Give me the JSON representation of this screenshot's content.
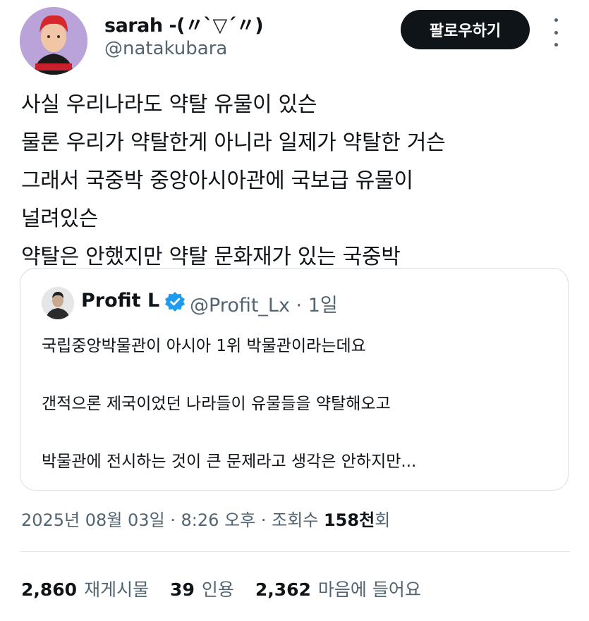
{
  "author": {
    "name": "sarah -(〃`▽´〃)",
    "handle": "@natakubara",
    "follow_label": "팔로우하기"
  },
  "tweet": {
    "lines": [
      "사실 우리나라도 약탈 유물이 있슨",
      "물론 우리가 약탈한게 아니라 일제가 약탈한 거슨",
      "그래서 국중박 중앙아시아관에 국보급 유물이",
      "널려있슨",
      "약탈은 안했지만 약탈 문화재가 있는 국중박"
    ]
  },
  "quote": {
    "name": "Profit L",
    "handle": "@Profit_Lx · 1일",
    "lines": [
      "국립중앙박물관이 아시아 1위 박물관이라는데요",
      "갠적으론 제국이었던 나라들이 유물들을 약탈해오고",
      "박물관에 전시하는 것이 큰 문제라고 생각은 안하지만..."
    ]
  },
  "meta": {
    "date_time": "2025년 08월 03일 · 8:26 오후 · 조회수 ",
    "views_value": "158천",
    "views_suffix": "회"
  },
  "stats": {
    "retweets_count": "2,860",
    "retweets_label": "재게시물",
    "quotes_count": "39",
    "quotes_label": "인용",
    "likes_count": "2,362",
    "likes_label": "마음에 들어요"
  },
  "colors": {
    "text": "#0f1419",
    "secondary": "#536471",
    "verified": "#1d9bf0",
    "border": "#d9dee2"
  },
  "icons": [
    "more-vertical-icon",
    "verified-badge-icon"
  ]
}
